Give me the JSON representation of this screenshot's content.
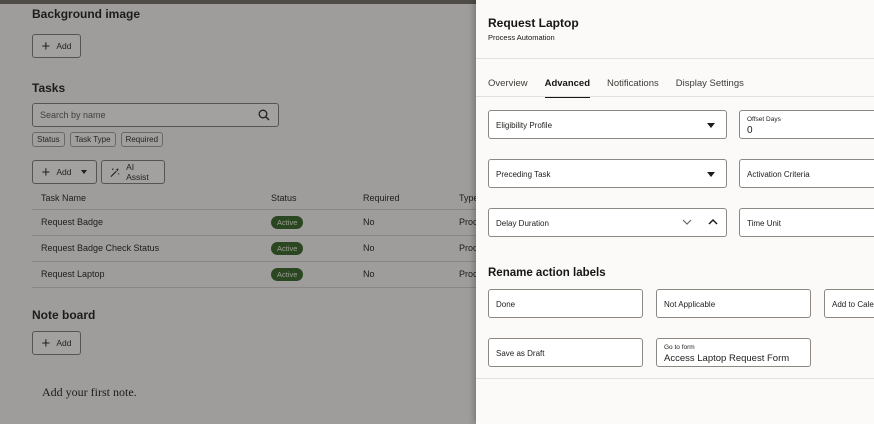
{
  "left": {
    "background_image": {
      "title": "Background image",
      "add_label": "Add"
    },
    "tasks": {
      "title": "Tasks",
      "search_placeholder": "Search by name",
      "filters": [
        "Status",
        "Task Type",
        "Required"
      ],
      "add_label": "Add",
      "ai_assist_label": "AI Assist",
      "columns": [
        "Task Name",
        "Status",
        "Required",
        "Type"
      ],
      "rows": [
        {
          "name": "Request Badge",
          "status": "Active",
          "required": "No",
          "type": "Proc"
        },
        {
          "name": "Request Badge Check Status",
          "status": "Active",
          "required": "No",
          "type": "Proc"
        },
        {
          "name": "Request Laptop",
          "status": "Active",
          "required": "No",
          "type": "Proc"
        }
      ]
    },
    "note_board": {
      "title": "Note board",
      "add_label": "Add",
      "empty_text": "Add your first note."
    }
  },
  "drawer": {
    "title": "Request Laptop",
    "subtitle": "Process Automation",
    "tabs": [
      "Overview",
      "Advanced",
      "Notifications",
      "Display Settings"
    ],
    "active_tab": "Advanced",
    "fields": {
      "eligibility_profile": "Eligibility Profile",
      "offset_days_label": "Offset Days",
      "offset_days_value": "0",
      "preceding_task": "Preceding Task",
      "activation_criteria": "Activation Criteria",
      "delay_duration": "Delay Duration",
      "time_unit": "Time Unit"
    },
    "rename_title": "Rename action labels",
    "actions": {
      "done": "Done",
      "not_applicable": "Not Applicable",
      "add_to_calendar": "Add to Calendar",
      "save_as_draft": "Save as Draft",
      "go_to_form_label": "Go to form",
      "go_to_form_value": "Access Laptop Request Form"
    }
  }
}
